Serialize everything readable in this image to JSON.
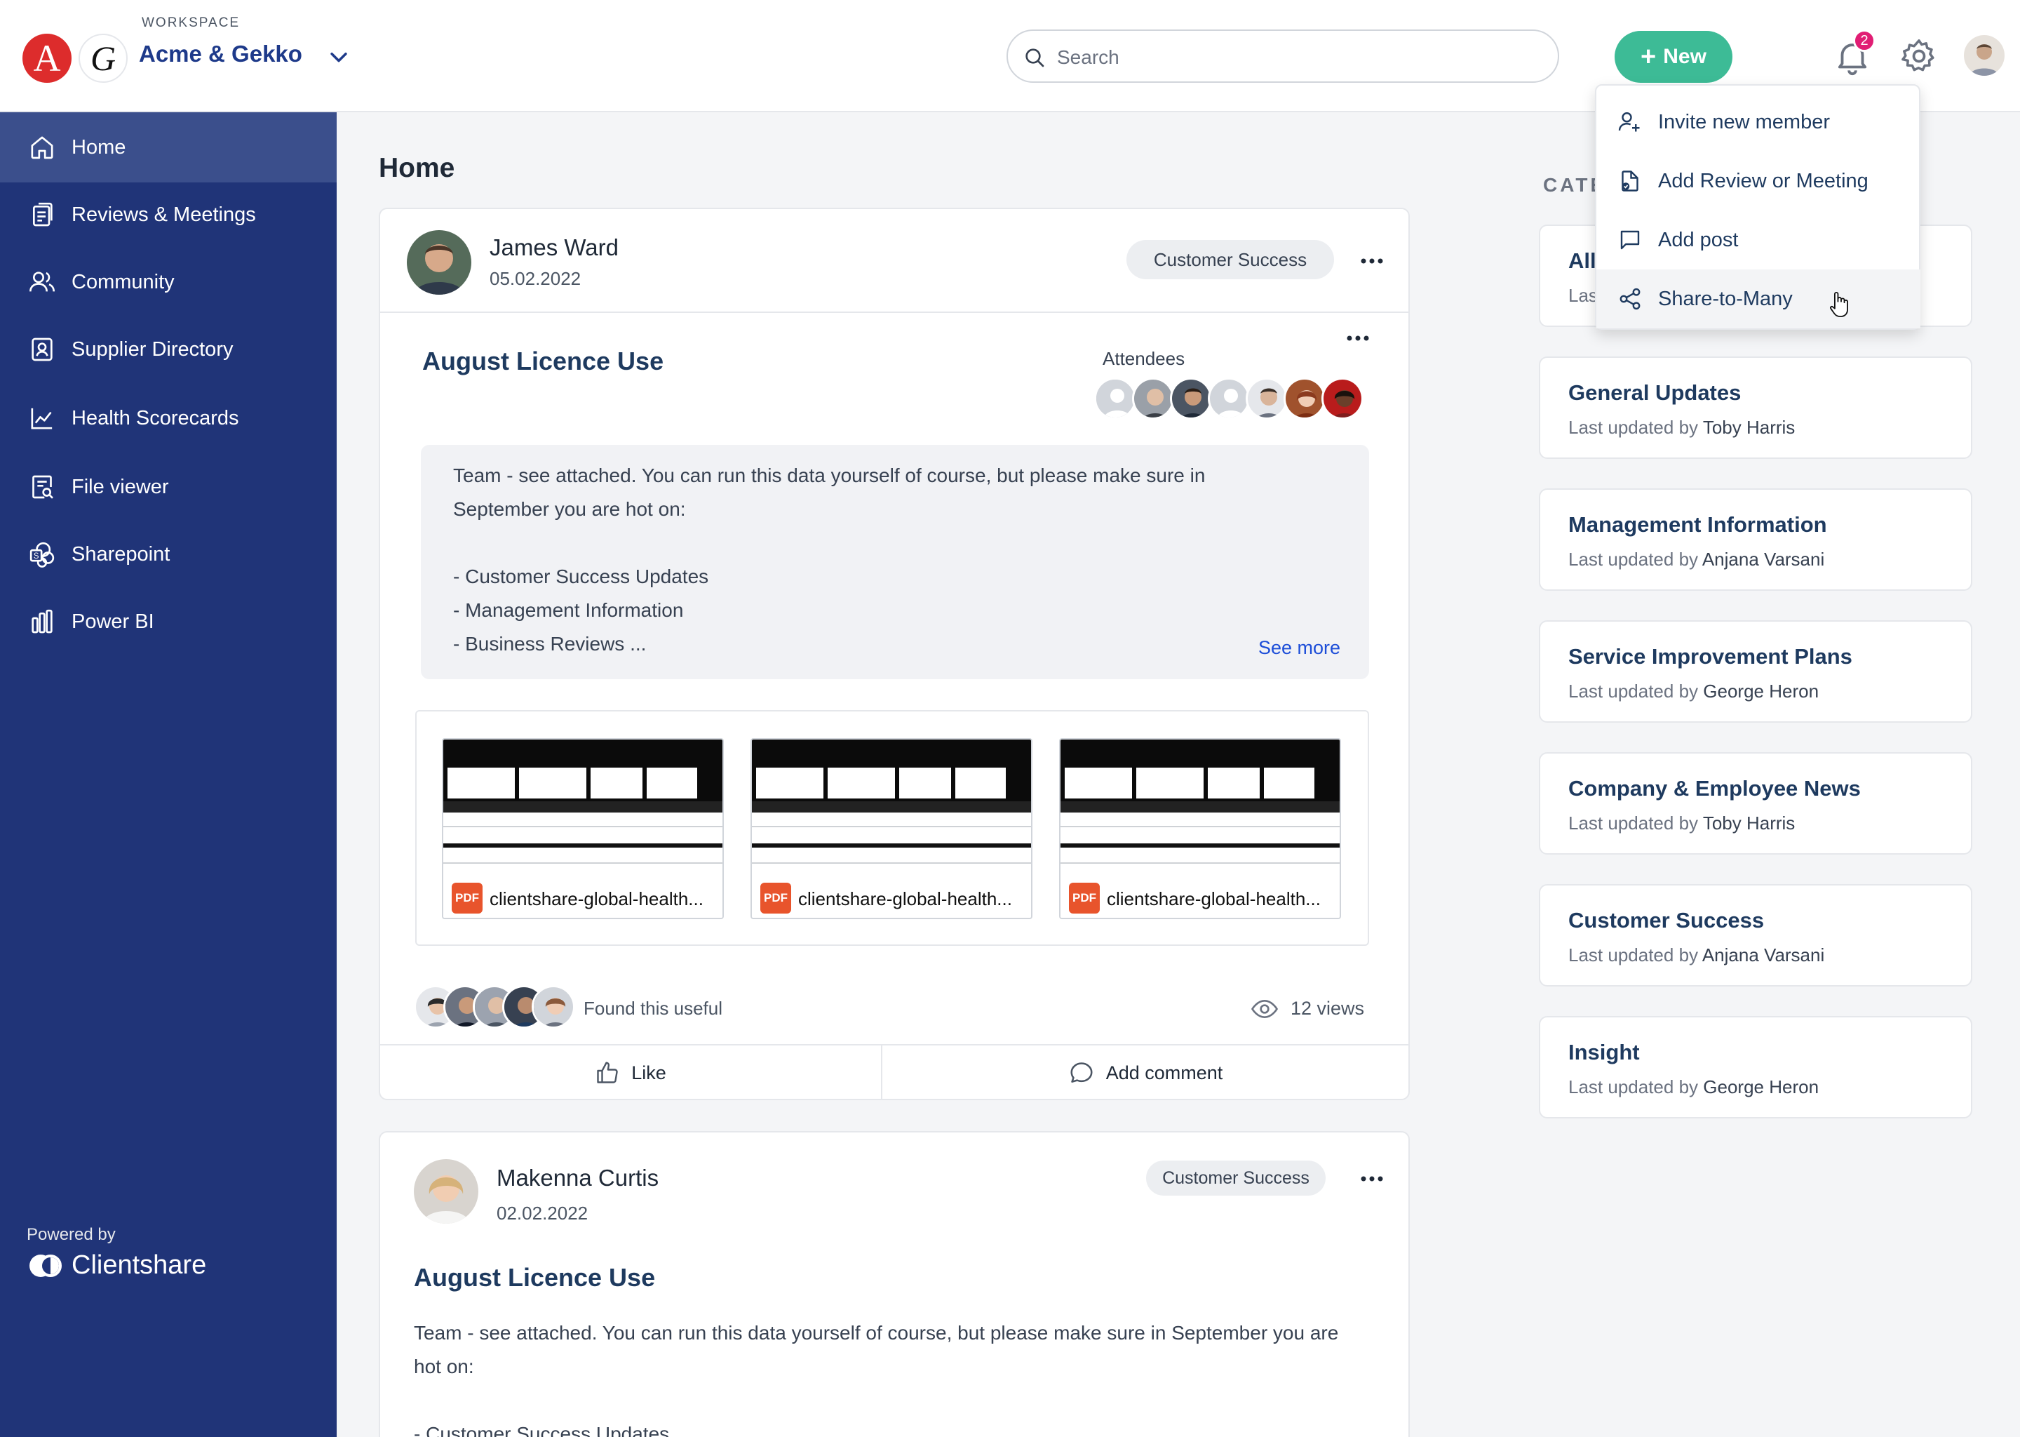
{
  "header": {
    "workspace_label": "WORKSPACE",
    "workspace_name": "Acme & Gekko",
    "logo_a": "A",
    "logo_g": "G",
    "search_placeholder": "Search",
    "new_label": "New",
    "notification_count": "2"
  },
  "new_menu": {
    "items": [
      {
        "label": "Invite new member",
        "icon": "add-user-icon"
      },
      {
        "label": "Add Review or Meeting",
        "icon": "document-check-icon"
      },
      {
        "label": "Add post",
        "icon": "message-icon"
      },
      {
        "label": "Share-to-Many",
        "icon": "share-icon"
      }
    ]
  },
  "sidebar": {
    "items": [
      {
        "label": "Home",
        "icon": "home-icon",
        "active": true
      },
      {
        "label": "Reviews & Meetings",
        "icon": "documents-icon"
      },
      {
        "label": "Community",
        "icon": "people-icon"
      },
      {
        "label": "Supplier Directory",
        "icon": "contact-card-icon"
      },
      {
        "label": "Health Scorecards",
        "icon": "chart-icon"
      },
      {
        "label": "File viewer",
        "icon": "file-search-icon"
      },
      {
        "label": "Sharepoint",
        "icon": "sharepoint-icon"
      },
      {
        "label": "Power BI",
        "icon": "powerbi-icon"
      }
    ],
    "powered_by": "Powered by",
    "brand": "Clientshare"
  },
  "main": {
    "title": "Home",
    "posts": [
      {
        "author": "James Ward",
        "date": "05.02.2022",
        "tag": "Customer Success",
        "title": "August Licence Use",
        "attendees_label": "Attendees",
        "body": "Team - see attached. You can run this data yourself of course, but please make sure in September you are hot on:\n\n- Customer Success Updates\n- Management Information\n- Business Reviews ...",
        "see_more": "See more",
        "attachments": [
          {
            "name": "clientshare-global-health...",
            "type": "PDF"
          },
          {
            "name": "clientshare-global-health...",
            "type": "PDF"
          },
          {
            "name": "clientshare-global-health...",
            "type": "PDF"
          }
        ],
        "useful_text": "Found this useful",
        "views": "12 views",
        "like_label": "Like",
        "comment_label": "Add comment"
      },
      {
        "author": "Makenna Curtis",
        "date": "02.02.2022",
        "tag": "Customer Success",
        "title": "August Licence Use",
        "body": "Team - see attached. You can run this data yourself of course, but please make sure in September you are hot on:\n\n- Customer Success Updates"
      }
    ]
  },
  "categories": {
    "heading": "CATEGORIES",
    "last_updated_prefix": "Last updated by",
    "items": [
      {
        "title": "All",
        "updated_by": ""
      },
      {
        "title": "General Updates",
        "updated_by": "Toby Harris"
      },
      {
        "title": "Management Information",
        "updated_by": "Anjana Varsani"
      },
      {
        "title": "Service Improvement Plans",
        "updated_by": "George Heron"
      },
      {
        "title": "Company & Employee News",
        "updated_by": "Toby Harris"
      },
      {
        "title": "Customer Success",
        "updated_by": "Anjana Varsani"
      },
      {
        "title": "Insight",
        "updated_by": "George Heron"
      }
    ]
  },
  "colors": {
    "sidebar": "#203478",
    "sidebar_active": "#3b4f8c",
    "accent_green": "#3dbb96",
    "badge": "#e11d74",
    "link": "#1d4ed8",
    "pdf": "#e8542c"
  }
}
